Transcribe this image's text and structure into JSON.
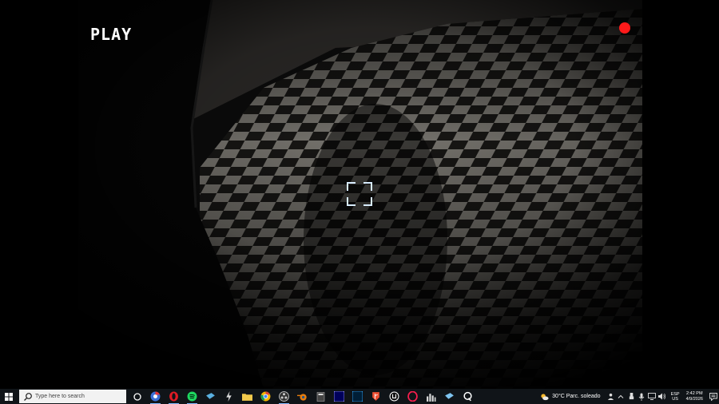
{
  "game": {
    "status_label": "PLAY",
    "recording_color": "#ff1a1a",
    "crosshair_icon": "focus-brackets-icon"
  },
  "taskbar": {
    "start_icon": "windows-logo-icon",
    "search_placeholder": "Type here to search",
    "apps": [
      {
        "name": "cortana",
        "icon": "circle-icon"
      },
      {
        "name": "chrome-alt",
        "icon": "chrome-icon"
      },
      {
        "name": "opera",
        "icon": "opera-icon"
      },
      {
        "name": "spotify",
        "icon": "spotify-icon"
      },
      {
        "name": "steam",
        "icon": "steam-icon"
      },
      {
        "name": "bolt",
        "icon": "bolt-icon"
      },
      {
        "name": "file-explorer",
        "icon": "folder-icon"
      },
      {
        "name": "chrome",
        "icon": "chrome-icon"
      },
      {
        "name": "obs",
        "icon": "obs-icon"
      },
      {
        "name": "blender",
        "icon": "blender-icon"
      },
      {
        "name": "calculator",
        "icon": "calculator-icon"
      },
      {
        "name": "after-effects",
        "icon": "after-effects-icon"
      },
      {
        "name": "photoshop",
        "icon": "photoshop-icon"
      },
      {
        "name": "git-fork",
        "icon": "fork-icon"
      },
      {
        "name": "unreal",
        "icon": "unreal-icon"
      },
      {
        "name": "opera-gx",
        "icon": "opera-gx-icon"
      },
      {
        "name": "audio-meter",
        "icon": "bars-icon"
      },
      {
        "name": "steam-2",
        "icon": "steam-icon"
      },
      {
        "name": "capture",
        "icon": "capture-icon"
      }
    ],
    "tray": {
      "temperature": "30°C",
      "weather": "Parc. soleado",
      "lang_top": "ESP",
      "lang_bottom": "US",
      "time": "2:42 PM",
      "date": "4/9/2026"
    }
  }
}
